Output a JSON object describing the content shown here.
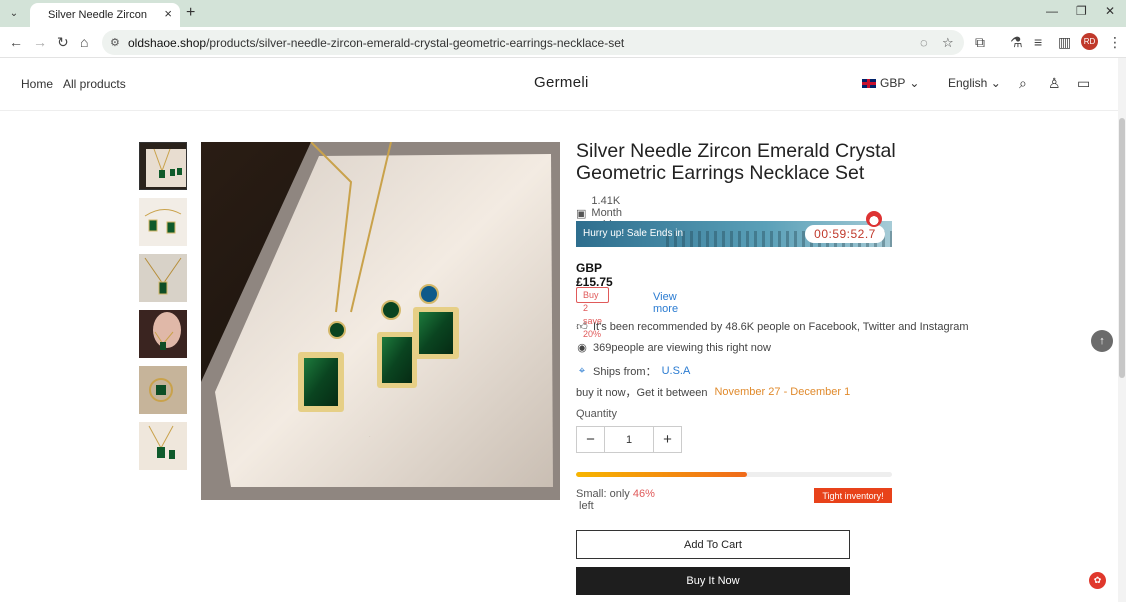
{
  "browser": {
    "tab_title": "Silver Needle Zircon Emerald C",
    "url_domain": "oldshaoe.shop",
    "url_path": "/products/silver-needle-zircon-emerald-crystal-geometric-earrings-necklace-set",
    "new_tab_symbol": "+",
    "avatar_initials": "RD"
  },
  "header": {
    "nav": [
      "Home",
      "All products"
    ],
    "brand": "Germeli",
    "currency": "GBP",
    "language": "English"
  },
  "product": {
    "title": "Silver Needle Zircon Emerald Crystal Geometric Earrings Necklace Set",
    "sold": "1.41K Month sold",
    "sale_banner": "Hurry up! Sale Ends in",
    "timer": "00:59:52.7",
    "price": "GBP £15.75",
    "promo": "Buy 2 save 20%",
    "view_more": "View more",
    "recommended": "It's been recommended by 48.6K people on Facebook, Twitter and Instagram",
    "viewing": "369people are viewing this right now",
    "ships_from_label": "Ships from：",
    "ships_from_value": "U.S.A",
    "delivery_prefix": "buy it now，Get it between",
    "delivery_start": "November 27",
    "delivery_sep": " - ",
    "delivery_end": "December 1",
    "quantity_label": "Quantity",
    "quantity_value": "1",
    "stock_prefix": "Small: only ",
    "stock_pct": "46%",
    "stock_suffix": " left",
    "stock_remaining_fraction": 0.54,
    "tight_badge": "Tight inventory!",
    "add_to_cart": "Add To Cart",
    "buy_now": "Buy It Now"
  },
  "colors": {
    "accent_blue": "#2a7bd1",
    "accent_orange": "#e08a2c",
    "badge_red": "#e8421a",
    "button_dark": "#1e1e1e"
  }
}
